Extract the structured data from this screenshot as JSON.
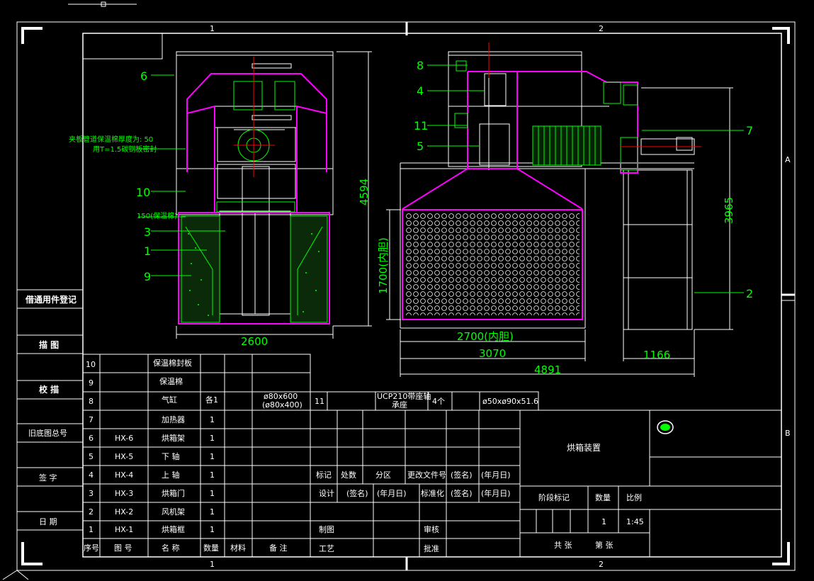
{
  "zone_labels": {
    "top": [
      "1",
      "2"
    ],
    "bottom": [
      "1",
      "2"
    ],
    "right": [
      "A",
      "B"
    ]
  },
  "side_labels": [
    "借通用件登记",
    "描 图",
    "校 描",
    "旧底图总号",
    "签 字",
    "日 期"
  ],
  "callouts_left": [
    "6",
    "10",
    "3",
    "1",
    "9"
  ],
  "callouts_right": [
    "8",
    "4",
    "11",
    "5",
    "7",
    "2"
  ],
  "notes": {
    "insulation": "夹板管道保温棉厚度为: 50",
    "plate": "用T=1.5碳钢板密封",
    "insulation_thickness": "150(保温棉)"
  },
  "dimensions": {
    "width_left": "2600",
    "height_left": "4594",
    "inner_height": "1700(内胆)",
    "inner_width": "2700(内胆)",
    "width_mid": "3070",
    "width_total": "4891",
    "width_right": "1166",
    "height_right": "3965"
  },
  "bom": {
    "headers": [
      "序号",
      "图 号",
      "名 称",
      "数量",
      "材料",
      "备 注"
    ],
    "rows": [
      {
        "no": "10",
        "code": "",
        "name": "保温棉封板",
        "qty": "",
        "mat": "",
        "note": ""
      },
      {
        "no": "9",
        "code": "",
        "name": "保温棉",
        "qty": "",
        "mat": "",
        "note": ""
      },
      {
        "no": "8",
        "code": "",
        "name": "气缸",
        "qty": "各1",
        "mat": "",
        "note": "ø80x600\n(ø80x400)"
      },
      {
        "no": "7",
        "code": "",
        "name": "加热器",
        "qty": "1",
        "mat": "",
        "note": ""
      },
      {
        "no": "6",
        "code": "HX-6",
        "name": "烘箱架",
        "qty": "1",
        "mat": "",
        "note": ""
      },
      {
        "no": "5",
        "code": "HX-5",
        "name": "下 轴",
        "qty": "1",
        "mat": "",
        "note": ""
      },
      {
        "no": "4",
        "code": "HX-4",
        "name": "上 轴",
        "qty": "1",
        "mat": "",
        "note": ""
      },
      {
        "no": "3",
        "code": "HX-3",
        "name": "烘箱门",
        "qty": "1",
        "mat": "",
        "note": ""
      },
      {
        "no": "2",
        "code": "HX-2",
        "name": "风机架",
        "qty": "1",
        "mat": "",
        "note": ""
      },
      {
        "no": "1",
        "code": "HX-1",
        "name": "烘箱框",
        "qty": "1",
        "mat": "",
        "note": ""
      }
    ],
    "row11": {
      "no": "11",
      "name": "UCP210带座轴承座",
      "qty": "4个",
      "note": "ø50xø90x51.6"
    }
  },
  "title_block": {
    "rev_headers": [
      "标记",
      "处数",
      "分区",
      "更改文件号",
      "(签名)",
      "(年月日)"
    ],
    "design_row": [
      "设计",
      "(签名)",
      "(年月日)",
      "标准化",
      "(签名)",
      "(年月日)"
    ],
    "drawn": "制图",
    "review": "审核",
    "process": "工艺",
    "approve": "批准",
    "title": "烘箱装置",
    "stage": "阶段标记",
    "qty_label": "数量",
    "scale_label": "比例",
    "qty": "1",
    "scale": "1:45",
    "sheets": "共 张",
    "sheet": "第 张"
  },
  "colors": {
    "line": "#ffffff",
    "green": "#00ff00",
    "magenta": "#ff00ff",
    "red": "#ff0000"
  }
}
